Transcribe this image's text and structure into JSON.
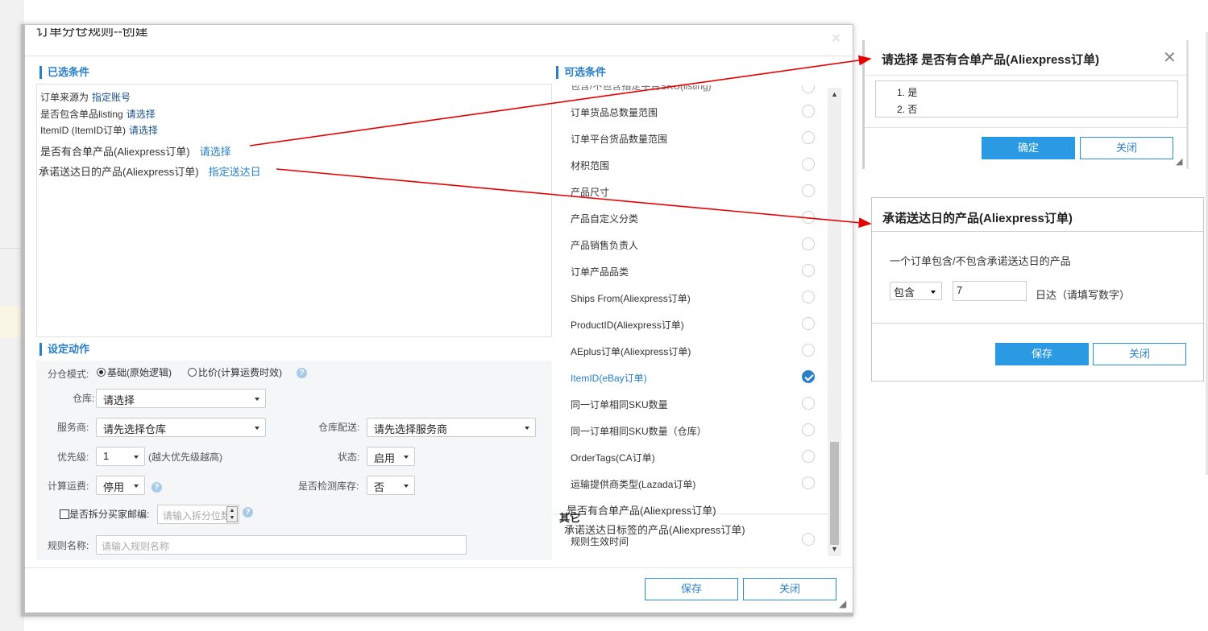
{
  "main_dialog": {
    "title": "订单分仓规则--创建",
    "selected_section": {
      "title": "已选条件"
    },
    "conditions": [
      {
        "label": "订单来源为",
        "link": "指定账号"
      },
      {
        "label": "是否包含单品listing",
        "link": "请选择"
      },
      {
        "label": "ItemID (ItemID订单)",
        "link": "请选择"
      },
      {
        "label": "是否有合单产品(Aliexpress订单)",
        "link": "请选择"
      },
      {
        "label": "承诺送达日的产品(Aliexpress订单)",
        "link": "指定送达日"
      }
    ],
    "action_section": {
      "title": "设定动作",
      "split_mode_label": "分仓模式:",
      "split_mode_options": [
        "基础(原始逻辑)",
        "比价(计算运费时效)"
      ],
      "warehouse_label": "仓库:",
      "warehouse_value": "请选择",
      "carrier_label": "服务商:",
      "carrier_value": "请先选择仓库",
      "wh_delivery_label": "仓库配送:",
      "wh_delivery_value": "请先选择服务商",
      "priority_label": "优先级:",
      "priority_value": "1",
      "priority_hint": "(越大优先级越高)",
      "status_label": "状态:",
      "status_value": "启用",
      "calc_freight_label": "计算运费:",
      "calc_freight_value": "停用",
      "check_stock_label": "是否检测库存:",
      "check_stock_value": "否",
      "split_zip_label": "是否拆分买家邮编:",
      "split_zip_placeholder": "请输入拆分位数",
      "rule_name_label": "规则名称:",
      "rule_name_placeholder": "请输入规则名称"
    },
    "optional_section": {
      "title": "可选条件",
      "top_cut_item": "包含/不包含指定平台SKU(listing)",
      "items": [
        {
          "label": "订单货品总数量范围",
          "checked": false
        },
        {
          "label": "订单平台货品数量范围",
          "checked": false
        },
        {
          "label": "材积范围",
          "checked": false
        },
        {
          "label": "产品尺寸",
          "checked": false
        },
        {
          "label": "产品自定义分类",
          "checked": false
        },
        {
          "label": "产品销售负责人",
          "checked": false
        },
        {
          "label": "订单产品品类",
          "checked": false
        },
        {
          "label": "Ships From(Aliexpress订单)",
          "checked": false
        },
        {
          "label": "ProductID(Aliexpress订单)",
          "checked": false
        },
        {
          "label": "AEplus订单(Aliexpress订单)",
          "checked": false
        },
        {
          "label": "ItemID(eBay订单)",
          "checked": true
        },
        {
          "label": "同一订单相同SKU数量",
          "checked": false
        },
        {
          "label": "同一订单相同SKU数量（仓库）",
          "checked": false
        },
        {
          "label": "OrderTags(CA订单)",
          "checked": false
        },
        {
          "label": "运输提供商类型(Lazada订单)",
          "checked": false
        }
      ],
      "overlay_item_1": "是否有合单产品(Aliexpress订单)",
      "other_group": "其它",
      "overlay_item_2": "承诺送达日标签的产品(Aliexpress订单)",
      "rule_effective_time": "规则生效时间"
    },
    "save_label": "保存",
    "close_label": "关闭"
  },
  "merge_dialog": {
    "title": "请选择 是否有合单产品(Aliexpress订单)",
    "options": [
      "1. 是",
      "2. 否"
    ],
    "confirm_label": "确定",
    "close_label": "关闭"
  },
  "promise_dialog": {
    "title": "承诺送达日的产品(Aliexpress订单)",
    "description": "一个订单包含/不包含承诺送达日的产品",
    "include_value": "包含",
    "days_value": "7",
    "days_hint": "日达（请填写数字）",
    "save_label": "保存",
    "close_label": "关闭"
  },
  "colors": {
    "accent": "#2a7fc9",
    "annotation_arrow": "#e60000",
    "button_solid": "#2a9ae2"
  }
}
